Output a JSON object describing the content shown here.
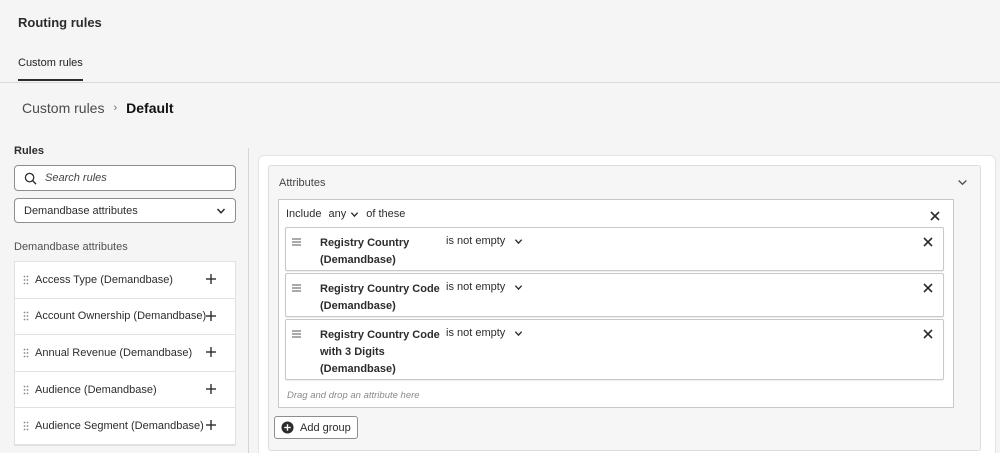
{
  "app": {
    "title": "Routing rules"
  },
  "tabs": [
    {
      "label": "Custom rules",
      "active": true
    }
  ],
  "breadcrumb": {
    "parent": "Custom rules",
    "current": "Default"
  },
  "rules_panel": {
    "title": "Rules",
    "search_placeholder": "Search rules",
    "selected_source": "Demandbase attributes",
    "list_title": "Demandbase attributes",
    "items": [
      {
        "label": "Access Type (Demandbase)"
      },
      {
        "label": "Account Ownership (Demandbase)"
      },
      {
        "label": "Annual Revenue (Demandbase)"
      },
      {
        "label": "Audience (Demandbase)"
      },
      {
        "label": "Audience Segment (Demandbase)"
      }
    ]
  },
  "attributes": {
    "title": "Attributes",
    "group": {
      "include_label": "Include",
      "qualifier": "any",
      "suffix": "of these",
      "conditions": [
        {
          "name_line1": "Registry Country",
          "name_line2": "(Demandbase)",
          "name_line3": "",
          "operator": "is not empty"
        },
        {
          "name_line1": "Registry Country Code",
          "name_line2": "(Demandbase)",
          "name_line3": "",
          "operator": "is not empty"
        },
        {
          "name_line1": "Registry Country Code",
          "name_line2": "with 3 Digits",
          "name_line3": "(Demandbase)",
          "operator": "is not empty"
        }
      ],
      "drop_hint": "Drag and drop an attribute here"
    },
    "add_group_label": "Add group"
  },
  "icons": {
    "search": "search-icon",
    "chevron": "chevron-down-icon",
    "close": "close-icon",
    "drag": "drag-handle-icon",
    "plus": "plus-icon",
    "add_circle": "add-circle-icon"
  }
}
